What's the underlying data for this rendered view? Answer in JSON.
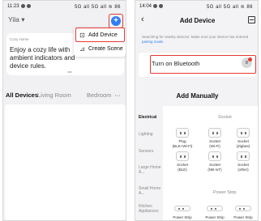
{
  "left": {
    "status": {
      "time": "11:23",
      "signal": "5G all 5G all ≋ 86"
    },
    "home_name": "Yila",
    "home_dropdown_glyph": "▾",
    "plus_glyph": "+",
    "card": {
      "caption": "Cozy Home",
      "text": "Enjoy a cozy life with ambient indicators and device rules."
    },
    "menu": {
      "add_device": "Add Device",
      "add_device_icon": "⊡",
      "create_scene": "Create Scene",
      "create_scene_icon": "⊿"
    },
    "tabs": [
      "All Devices",
      "Living Room",
      "Bedroom",
      "···"
    ]
  },
  "right": {
    "status": {
      "time": "14:04",
      "signal": "5G all 5G all ≋ 86"
    },
    "back_glyph": "‹",
    "title": "Add Device",
    "search_text": "Searching for nearby devices. Make sure your device has entered",
    "search_link": "pairing mode.",
    "bluetooth": {
      "label": "Turn on Bluetooth",
      "icon_glyph": "ʙ"
    },
    "add_manually": "Add Manually",
    "categories": [
      "Electrical",
      "Lighting",
      "Sensors",
      "Large Home A...",
      "Small Home A...",
      "Kitchen Appliances"
    ],
    "sections": {
      "socket": "Socket",
      "strip": "Power Strip"
    },
    "devices": [
      {
        "name": "Plug\n(BLE+Wi-Fi)"
      },
      {
        "name": "Socket\n(Wi-Fi)"
      },
      {
        "name": "Socket\n(Zigbee)"
      },
      {
        "name": "Socket\n(BLE)"
      },
      {
        "name": "Socket\n(NB-IoT)"
      },
      {
        "name": "Socket\n(other)"
      },
      {
        "name": "Power Strip"
      },
      {
        "name": "Power Strip"
      },
      {
        "name": "Power Strip"
      }
    ],
    "accent_color": "#2f7cf6",
    "highlight_color": "#e53935"
  }
}
